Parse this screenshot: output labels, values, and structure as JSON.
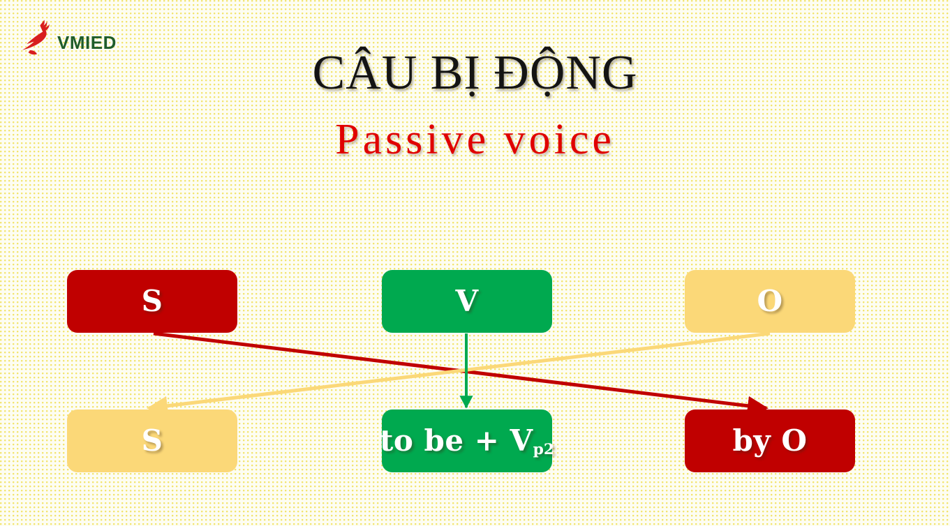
{
  "logo": {
    "mark": "bird-logo-icon",
    "text": "VMIED",
    "mark_color": "#D81E1E",
    "text_color": "#1E5C2A"
  },
  "title": {
    "vietnamese": "CÂU BỊ ĐỘNG",
    "english": "Passive voice",
    "vietnamese_color": "#141414",
    "english_color": "#E00000"
  },
  "diagram": {
    "active_row": [
      {
        "id": "s-top",
        "label": "S",
        "color": "#C00000",
        "role": "subject"
      },
      {
        "id": "v-top",
        "label": "V",
        "color": "#00A94F",
        "role": "verb"
      },
      {
        "id": "o-top",
        "label": "O",
        "color": "#FBD878",
        "role": "object"
      }
    ],
    "passive_row": [
      {
        "id": "s-bot",
        "label": "S",
        "color": "#FBD878",
        "role": "subject"
      },
      {
        "id": "v-bot",
        "label": "to be + V",
        "label_sub": "p2",
        "color": "#00A94F",
        "role": "verb"
      },
      {
        "id": "o-bot",
        "label": "by O",
        "color": "#C00000",
        "role": "agent"
      }
    ],
    "arrows": [
      {
        "id": "arrow-s-to-byo",
        "from": "s-top",
        "to": "o-bot",
        "color": "#C00000"
      },
      {
        "id": "arrow-v-to-tobe",
        "from": "v-top",
        "to": "v-bot",
        "color": "#00A94F"
      },
      {
        "id": "arrow-o-to-s",
        "from": "o-top",
        "to": "s-bot",
        "color": "#FBD878"
      }
    ]
  },
  "background": {
    "base_color": "#FDFDF2",
    "dot_color": "#F2E36A"
  }
}
